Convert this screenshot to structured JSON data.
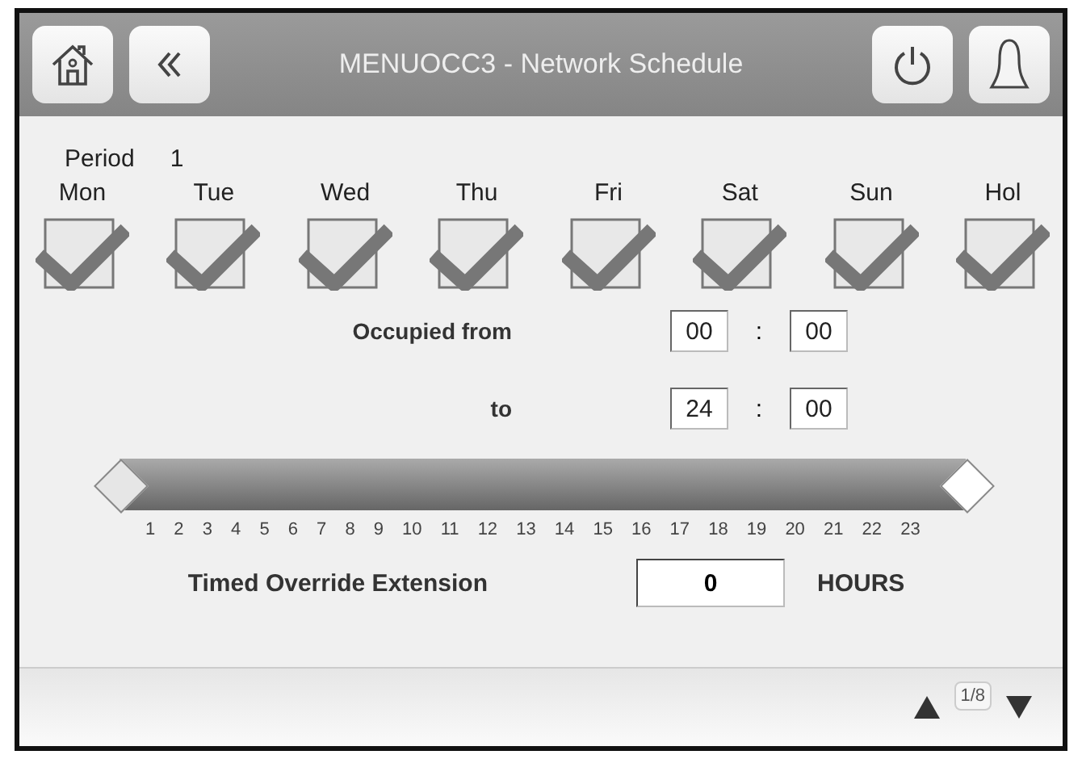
{
  "header": {
    "title": "MENUOCC3 - Network Schedule"
  },
  "period": {
    "label": "Period",
    "value": "1"
  },
  "days": [
    {
      "label": "Mon",
      "checked": true
    },
    {
      "label": "Tue",
      "checked": true
    },
    {
      "label": "Wed",
      "checked": true
    },
    {
      "label": "Thu",
      "checked": true
    },
    {
      "label": "Fri",
      "checked": true
    },
    {
      "label": "Sat",
      "checked": true
    },
    {
      "label": "Sun",
      "checked": true
    },
    {
      "label": "Hol",
      "checked": true
    }
  ],
  "occupied_from": {
    "label": "Occupied from",
    "hours": "00",
    "separator": ":",
    "minutes": "00"
  },
  "occupied_to": {
    "label": "to",
    "hours": "24",
    "separator": ":",
    "minutes": "00"
  },
  "slider": {
    "thumbs": [
      {
        "level": 0
      },
      {
        "level": 1
      }
    ],
    "ticks": [
      "1",
      "2",
      "3",
      "4",
      "5",
      "6",
      "7",
      "8",
      "9",
      "10",
      "11",
      "12",
      "13",
      "14",
      "15",
      "16",
      "17",
      "18",
      "19",
      "20",
      "21",
      "22",
      "23"
    ]
  },
  "override": {
    "label": "Timed Override Extension",
    "value": "0",
    "unit": "HOURS"
  },
  "footer": {
    "page": "1/8"
  }
}
